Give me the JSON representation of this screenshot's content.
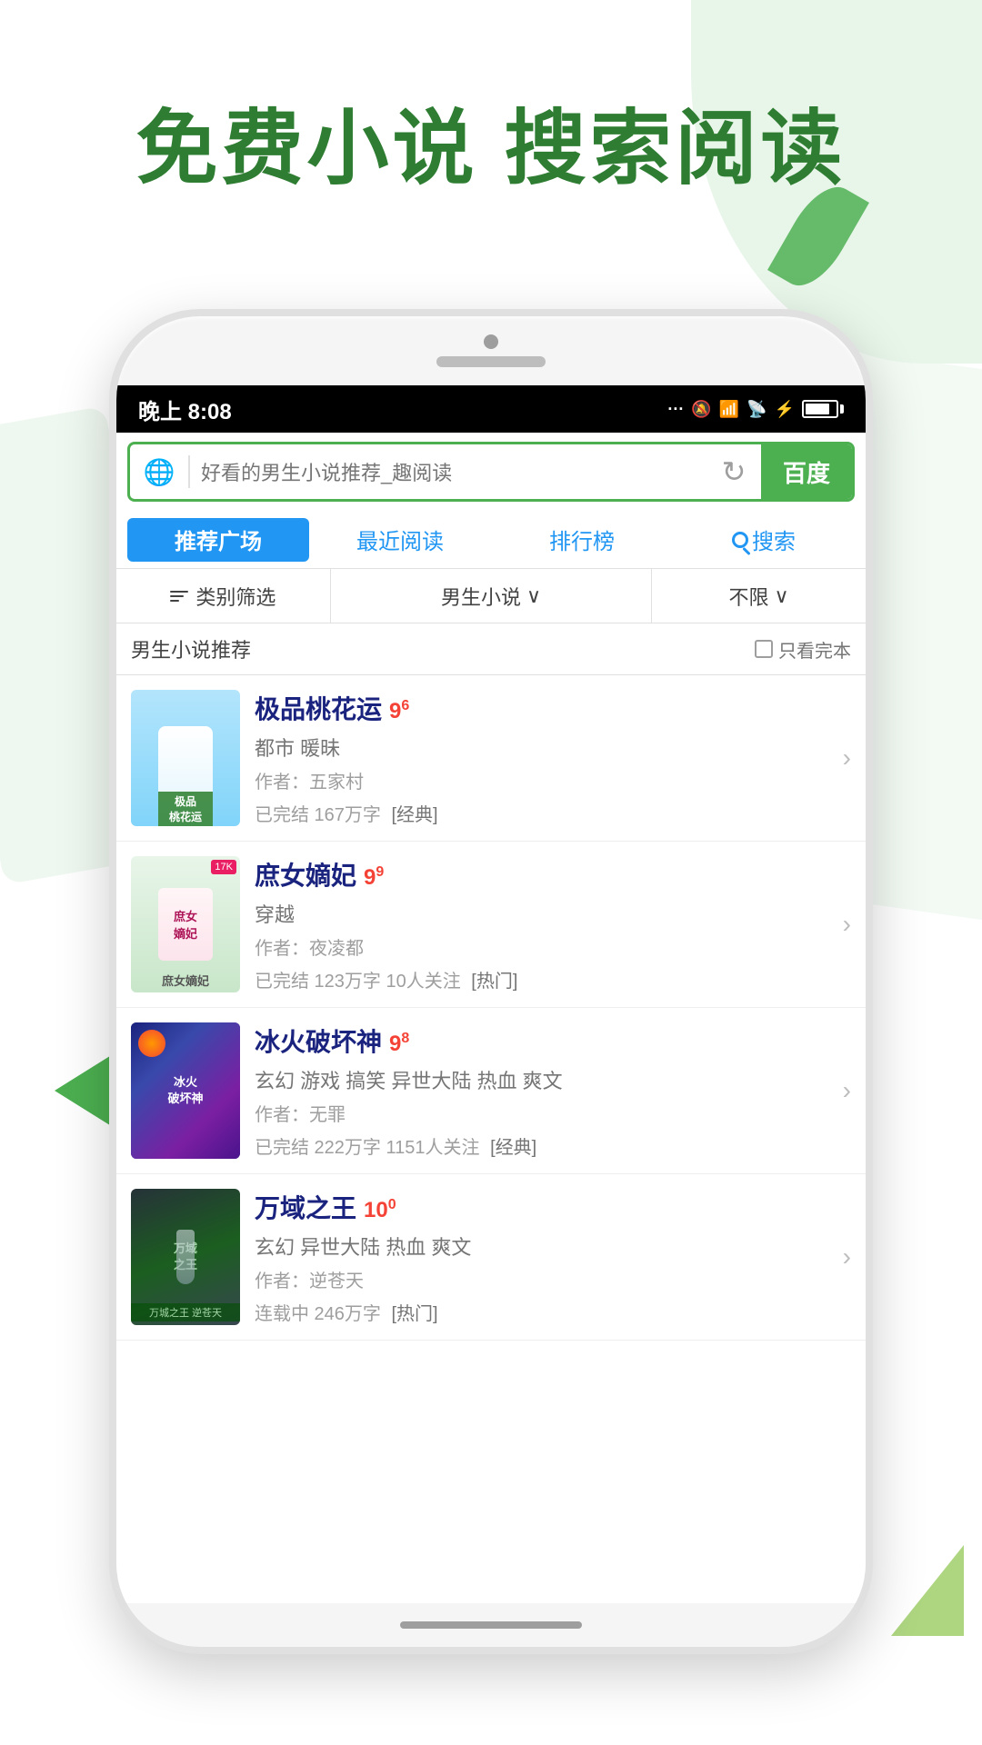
{
  "title": "免费小说 搜索阅读",
  "bg": {
    "color": "#ffffff"
  },
  "statusBar": {
    "time": "晚上 8:08",
    "icons": "... 🔔 WiFi 📶 ⚡"
  },
  "searchBar": {
    "placeholder": "好看的男生小说推荐_趣阅读",
    "baiduLabel": "百度"
  },
  "navTabs": [
    {
      "label": "推荐广场",
      "active": true
    },
    {
      "label": "最近阅读",
      "active": false
    },
    {
      "label": "排行榜",
      "active": false
    },
    {
      "label": "搜索",
      "active": false
    }
  ],
  "filterBar": {
    "category": "类别筛选",
    "type": "男生小说",
    "typeIcon": "∨",
    "limit": "不限",
    "limitIcon": "∨"
  },
  "sectionHeader": {
    "title": "男生小说推荐",
    "checkboxLabel": "只看完本"
  },
  "books": [
    {
      "title": "极品桃花运",
      "rating": "9",
      "ratingSup": "6",
      "genre": "都市 暖昧",
      "author": "作者：五家村",
      "meta": "已完结 167万字",
      "tag": "[经典]",
      "coverAlt": "极品桃花运"
    },
    {
      "title": "庶女嫡妃",
      "rating": "9",
      "ratingSup": "9",
      "genre": "穿越",
      "author": "作者：夜凌都",
      "meta": "已完结 123万字 10人关注",
      "tag": "[热门]",
      "coverAlt": "庶女嫡妃"
    },
    {
      "title": "冰火破坏神",
      "rating": "9",
      "ratingSup": "8",
      "genre": "玄幻 游戏 搞笑 异世大陆 热血 爽文",
      "author": "作者：无罪",
      "meta": "已完结 222万字 1151人关注",
      "tag": "[经典]",
      "coverAlt": "冰火破坏神"
    },
    {
      "title": "万域之王",
      "rating": "10",
      "ratingSup": "0",
      "genre": "玄幻 异世大陆 热血 爽文",
      "author": "作者：逆苍天",
      "meta": "连载中 246万字",
      "tag": "[热门]",
      "coverAlt": "万域之王"
    }
  ]
}
